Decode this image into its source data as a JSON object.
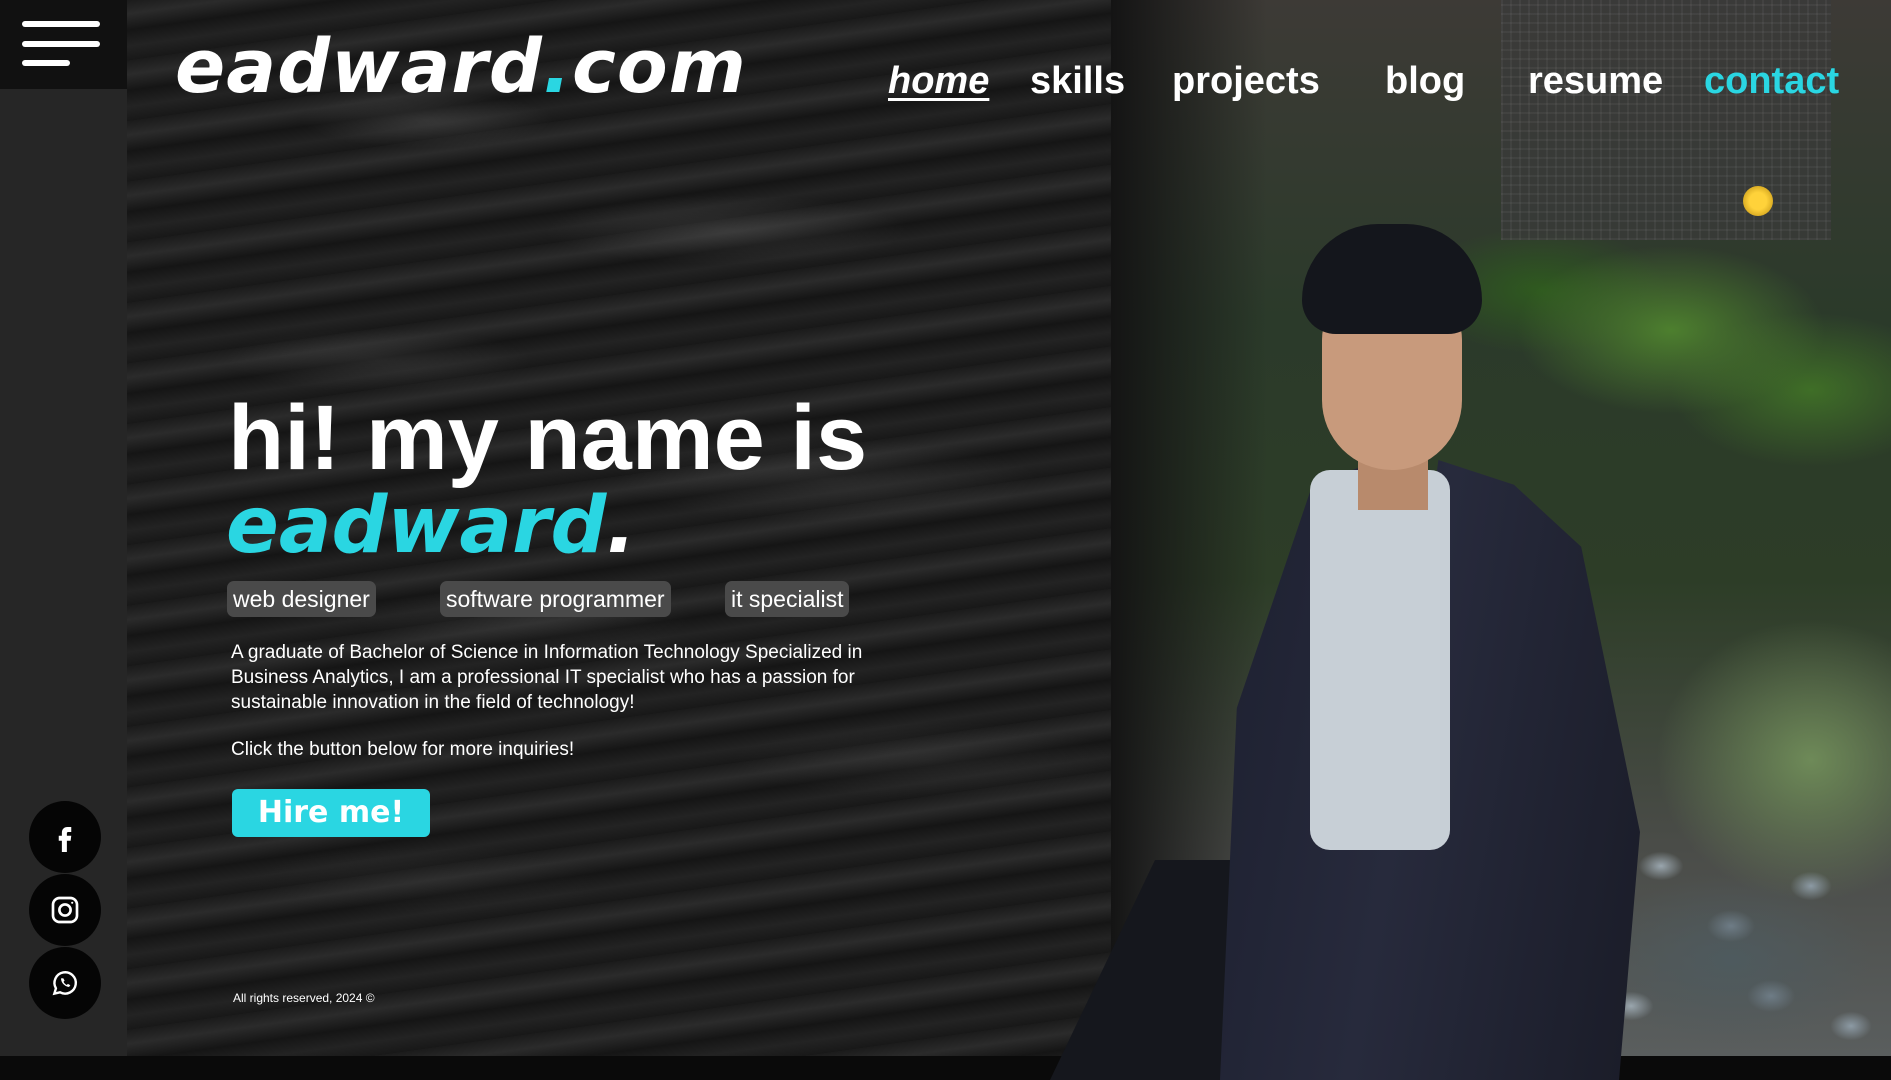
{
  "brand": {
    "logo_main": "eadward",
    "logo_dot": ".",
    "logo_tld": "com",
    "accent_color": "#2ad6e2"
  },
  "nav": {
    "home": "home",
    "skills": "skills",
    "projects": "projects",
    "blog": "blog",
    "resume": "resume",
    "contact": "contact"
  },
  "hero": {
    "greeting": "hi! my name is",
    "name": "eadward",
    "name_punct": ".",
    "tags": [
      "web designer",
      "software programmer",
      "it specialist"
    ],
    "description": "A graduate of Bachelor of Science in Information Technology Specialized in Business Analytics, I am a professional IT specialist who has a passion for sustainable innovation in the field of technology!",
    "cta_text": "Click the button below for more inquiries!",
    "hire_button": "Hire me!"
  },
  "footer": {
    "copyright": "All rights reserved, 2024 ©"
  },
  "sidebar": {
    "menu_icon": "hamburger-menu-icon",
    "social": [
      "facebook-icon",
      "instagram-icon",
      "whatsapp-icon"
    ]
  }
}
